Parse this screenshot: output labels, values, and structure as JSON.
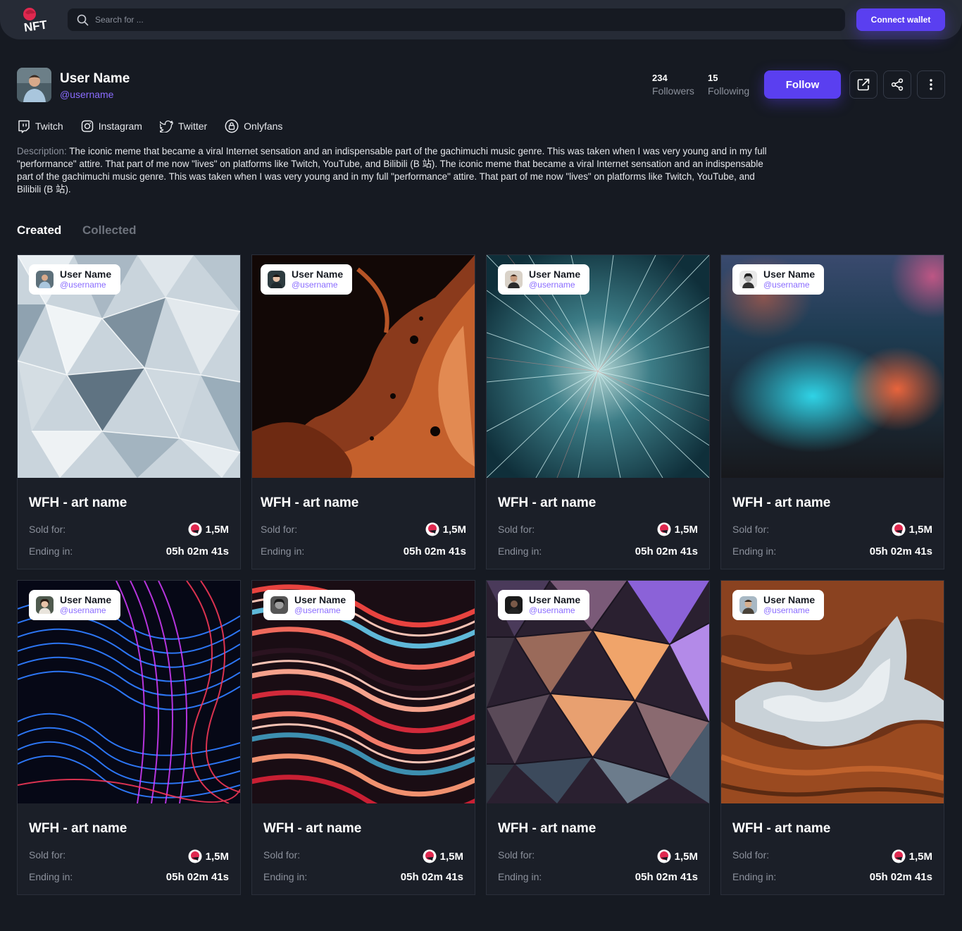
{
  "header": {
    "logo_text": "NFT",
    "search_placeholder": "Search for ...",
    "connect_label": "Connect wallet"
  },
  "profile": {
    "name": "User Name",
    "handle": "@username",
    "followers_count": "234",
    "followers_label": "Followers",
    "following_count": "15",
    "following_label": "Following",
    "follow_label": "Follow",
    "socials": [
      "Twitch",
      "Instagram",
      "Twitter",
      "Onlyfans"
    ],
    "description_label": "Description:",
    "description": "The iconic meme that became a viral Internet sensation and an indispensable part of the gachimuchi music genre. This was taken when I was very young and in my full \"performance\" attire. That part of me now \"lives\" on platforms like Twitch, YouTube, and Bilibili (B 站). The iconic meme that became a viral Internet sensation and an indispensable part of the gachimuchi music genre. This was taken when I was very young and in my full \"performance\" attire. That part of me now \"lives\" on platforms like Twitch, YouTube, and Bilibili (B 站)."
  },
  "tabs": [
    "Created",
    "Collected"
  ],
  "cards": [
    {
      "creator": "User Name",
      "handle": "@username",
      "title": "WFH - art name",
      "sold_label": "Sold for:",
      "price": "1,5M",
      "ending_label": "Ending in:",
      "timer": "05h 02m 41s"
    },
    {
      "creator": "User Name",
      "handle": "@username",
      "title": "WFH - art name",
      "sold_label": "Sold for:",
      "price": "1,5M",
      "ending_label": "Ending in:",
      "timer": "05h 02m 41s"
    },
    {
      "creator": "User Name",
      "handle": "@username",
      "title": "WFH - art name",
      "sold_label": "Sold for:",
      "price": "1,5M",
      "ending_label": "Ending in:",
      "timer": "05h 02m 41s"
    },
    {
      "creator": "User Name",
      "handle": "@username",
      "title": "WFH - art name",
      "sold_label": "Sold for:",
      "price": "1,5M",
      "ending_label": "Ending in:",
      "timer": "05h 02m 41s"
    },
    {
      "creator": "User Name",
      "handle": "@username",
      "title": "WFH - art name",
      "sold_label": "Sold for:",
      "price": "1,5M",
      "ending_label": "Ending in:",
      "timer": "05h 02m 41s"
    },
    {
      "creator": "User Name",
      "handle": "@username",
      "title": "WFH - art name",
      "sold_label": "Sold for:",
      "price": "1,5M",
      "ending_label": "Ending in:",
      "timer": "05h 02m 41s"
    },
    {
      "creator": "User Name",
      "handle": "@username",
      "title": "WFH - art name",
      "sold_label": "Sold for:",
      "price": "1,5M",
      "ending_label": "Ending in:",
      "timer": "05h 02m 41s"
    },
    {
      "creator": "User Name",
      "handle": "@username",
      "title": "WFH - art name",
      "sold_label": "Sold for:",
      "price": "1,5M",
      "ending_label": "Ending in:",
      "timer": "05h 02m 41s"
    }
  ],
  "colors": {
    "accent": "#5a3ff0",
    "handle": "#8a6cff",
    "background": "#161a22",
    "topbar": "#262b36"
  }
}
